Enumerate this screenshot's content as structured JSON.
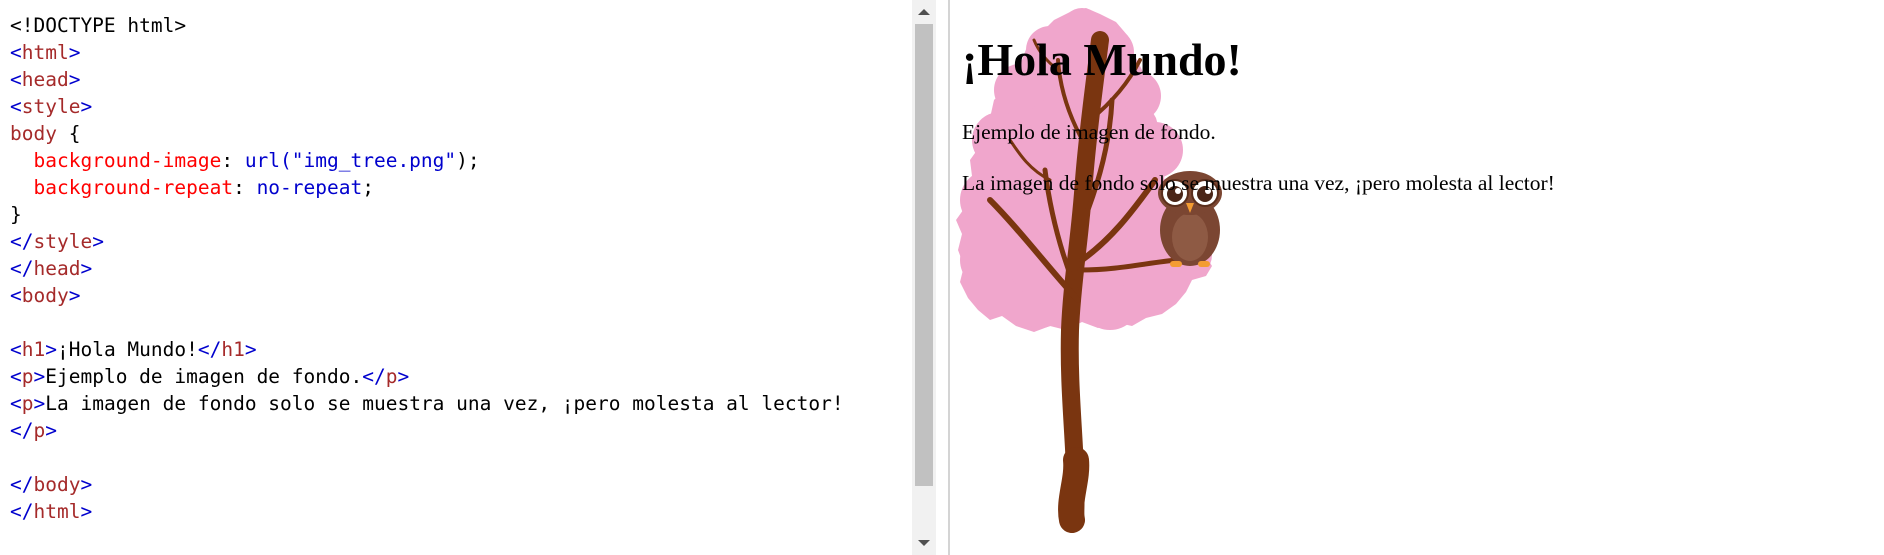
{
  "editor": {
    "lines": [
      [
        {
          "t": "<!DOCTYPE html>",
          "c": "plain"
        }
      ],
      [
        {
          "t": "<",
          "c": "br"
        },
        {
          "t": "html",
          "c": "tag"
        },
        {
          "t": ">",
          "c": "br"
        }
      ],
      [
        {
          "t": "<",
          "c": "br"
        },
        {
          "t": "head",
          "c": "tag"
        },
        {
          "t": ">",
          "c": "br"
        }
      ],
      [
        {
          "t": "<",
          "c": "br"
        },
        {
          "t": "style",
          "c": "tag"
        },
        {
          "t": ">",
          "c": "br"
        }
      ],
      [
        {
          "t": "body",
          "c": "tag"
        },
        {
          "t": " {",
          "c": "plain"
        }
      ],
      [
        {
          "t": "  ",
          "c": "plain"
        },
        {
          "t": "background-image",
          "c": "prop"
        },
        {
          "t": ": ",
          "c": "plain"
        },
        {
          "t": "url(",
          "c": "val"
        },
        {
          "t": "\"img_tree.png\"",
          "c": "val"
        },
        {
          "t": ");",
          "c": "plain"
        }
      ],
      [
        {
          "t": "  ",
          "c": "plain"
        },
        {
          "t": "background-repeat",
          "c": "prop"
        },
        {
          "t": ": ",
          "c": "plain"
        },
        {
          "t": "no-repeat",
          "c": "val"
        },
        {
          "t": ";",
          "c": "plain"
        }
      ],
      [
        {
          "t": "}",
          "c": "plain"
        }
      ],
      [
        {
          "t": "</",
          "c": "br"
        },
        {
          "t": "style",
          "c": "tag"
        },
        {
          "t": ">",
          "c": "br"
        }
      ],
      [
        {
          "t": "</",
          "c": "br"
        },
        {
          "t": "head",
          "c": "tag"
        },
        {
          "t": ">",
          "c": "br"
        }
      ],
      [
        {
          "t": "<",
          "c": "br"
        },
        {
          "t": "body",
          "c": "tag"
        },
        {
          "t": ">",
          "c": "br"
        }
      ],
      [],
      [
        {
          "t": "<",
          "c": "br"
        },
        {
          "t": "h1",
          "c": "tag"
        },
        {
          "t": ">",
          "c": "br"
        },
        {
          "t": "¡Hola Mundo!",
          "c": "plain"
        },
        {
          "t": "</",
          "c": "br"
        },
        {
          "t": "h1",
          "c": "tag"
        },
        {
          "t": ">",
          "c": "br"
        }
      ],
      [
        {
          "t": "<",
          "c": "br"
        },
        {
          "t": "p",
          "c": "tag"
        },
        {
          "t": ">",
          "c": "br"
        },
        {
          "t": "Ejemplo de imagen de fondo.",
          "c": "plain"
        },
        {
          "t": "</",
          "c": "br"
        },
        {
          "t": "p",
          "c": "tag"
        },
        {
          "t": ">",
          "c": "br"
        }
      ],
      [
        {
          "t": "<",
          "c": "br"
        },
        {
          "t": "p",
          "c": "tag"
        },
        {
          "t": ">",
          "c": "br"
        },
        {
          "t": "La imagen de fondo solo se muestra una vez, ¡pero molesta al lector!",
          "c": "plain"
        }
      ],
      [
        {
          "t": "</",
          "c": "br"
        },
        {
          "t": "p",
          "c": "tag"
        },
        {
          "t": ">",
          "c": "br"
        }
      ],
      [],
      [
        {
          "t": "</",
          "c": "br"
        },
        {
          "t": "body",
          "c": "tag"
        },
        {
          "t": ">",
          "c": "br"
        }
      ],
      [
        {
          "t": "</",
          "c": "br"
        },
        {
          "t": "html",
          "c": "tag"
        },
        {
          "t": ">",
          "c": "br"
        }
      ]
    ],
    "colors": {
      "tag": "#a52a2a",
      "bracket": "#0000cd",
      "property": "#ff0000",
      "value": "#0000cd",
      "plain": "#000000"
    }
  },
  "scrollbar": {
    "up_icon": "triangle-up-icon",
    "down_icon": "triangle-down-icon"
  },
  "preview": {
    "heading": "¡Hola Mundo!",
    "paragraph1": "Ejemplo de imagen de fondo.",
    "paragraph2": "La imagen de fondo solo se muestra una vez, ¡pero molesta al lector!",
    "background_image": "pink-tree-with-owl",
    "colors": {
      "foliage": "#f0a6cc",
      "trunk": "#7a3510",
      "owl_body": "#7b4632",
      "owl_feet": "#f39c32"
    }
  }
}
